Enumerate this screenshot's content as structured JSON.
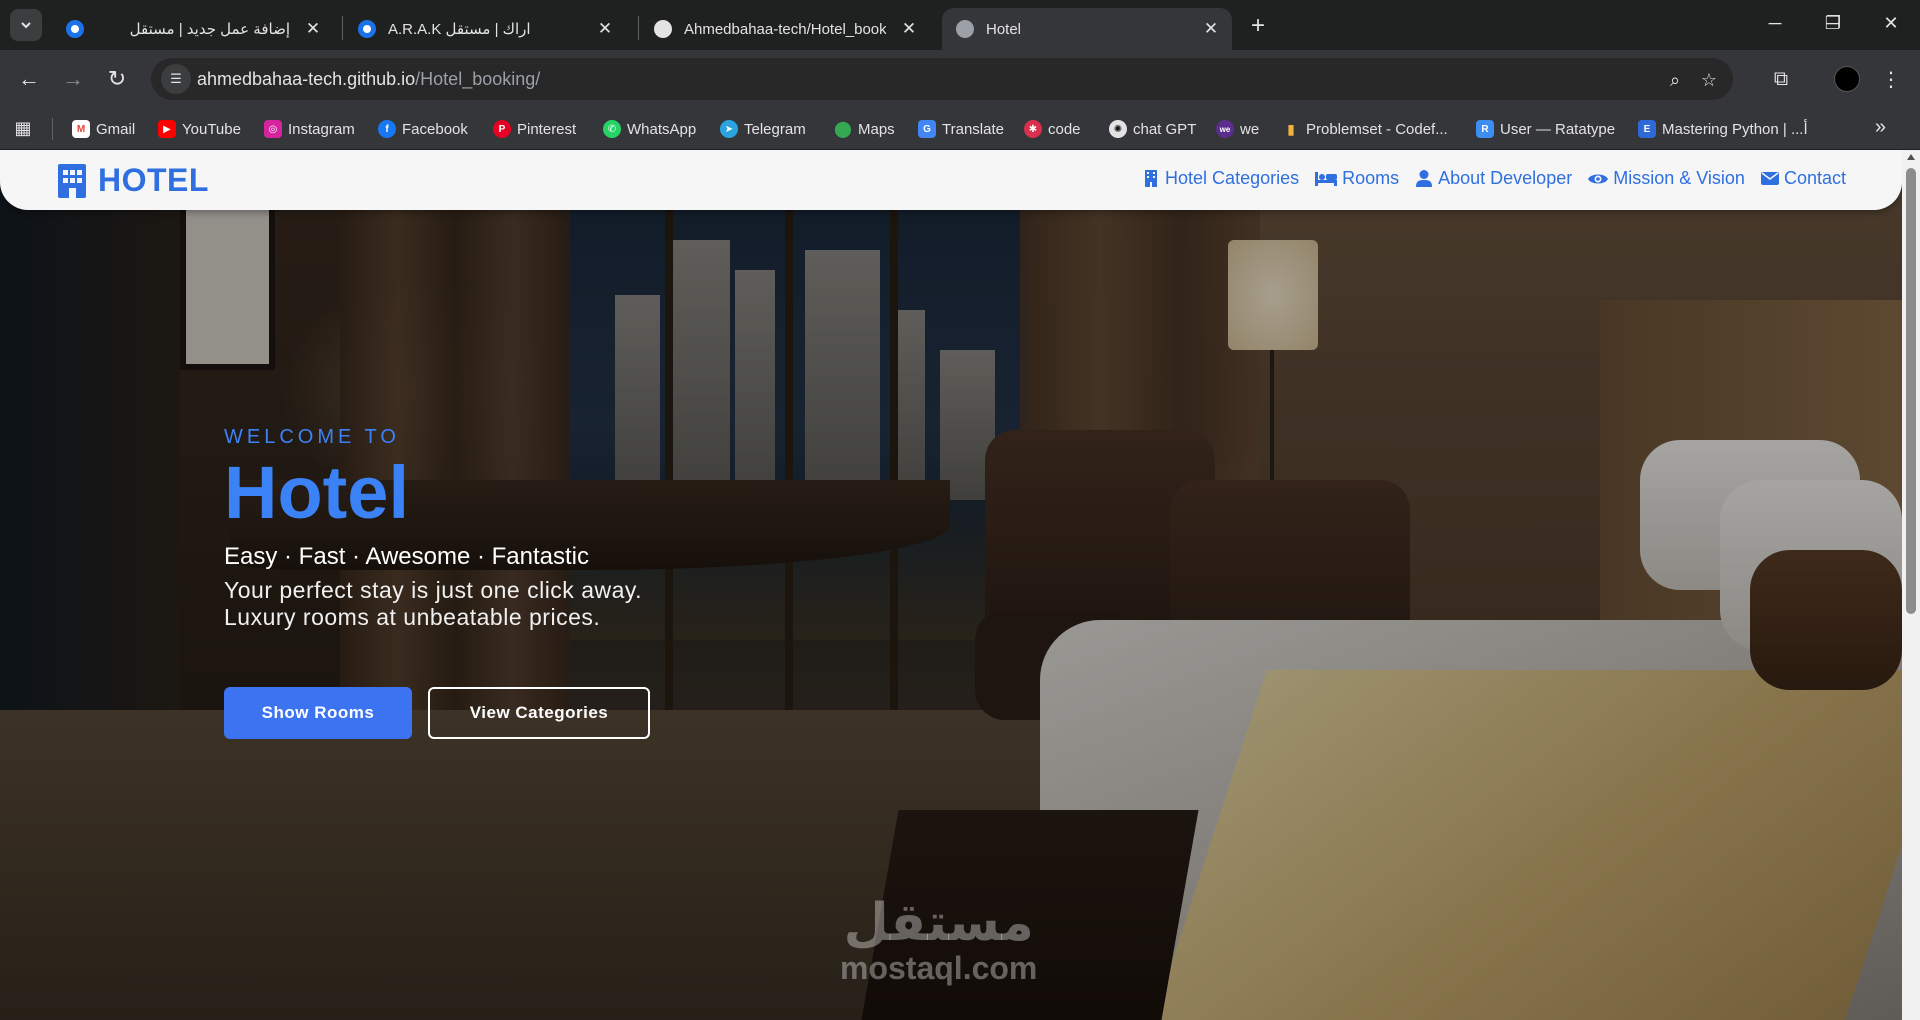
{
  "browser": {
    "tabs": [
      {
        "title": "إضافة عمل جديد | مستقل",
        "favicon": "mostaql-icon",
        "active": false
      },
      {
        "title": "A.R.A.K اراك | مستقل",
        "favicon": "mostaql-icon",
        "active": false
      },
      {
        "title": "Ahmedbahaa-tech/Hotel_booking",
        "favicon": "github-icon",
        "active": false
      },
      {
        "title": "Hotel",
        "favicon": "globe-icon",
        "active": true
      }
    ],
    "url_host": "ahmedbahaa-tech.github.io",
    "url_path": "/Hotel_booking/",
    "bookmarks": [
      {
        "label": "Gmail",
        "color": "#ea4335"
      },
      {
        "label": "YouTube",
        "color": "#ff0000"
      },
      {
        "label": "Instagram",
        "color": "#d6249f"
      },
      {
        "label": "Facebook",
        "color": "#1877f2"
      },
      {
        "label": "Pinterest",
        "color": "#e60023"
      },
      {
        "label": "WhatsApp",
        "color": "#25d366"
      },
      {
        "label": "Telegram",
        "color": "#2aa3e0"
      },
      {
        "label": "Maps",
        "color": "#34a853"
      },
      {
        "label": "Translate",
        "color": "#4285f4"
      },
      {
        "label": "code",
        "color": "#d9304f"
      },
      {
        "label": "chat GPT",
        "color": "#e3e3e3"
      },
      {
        "label": "we",
        "color": "#5b2d8e"
      },
      {
        "label": "Problemset - Codef...",
        "color": "#f2b33d"
      },
      {
        "label": "User — Ratatype",
        "color": "#3d8ef2"
      },
      {
        "label": "Mastering Python | ...أ",
        "color": "#2d6ad8"
      }
    ]
  },
  "site": {
    "brand": "HOTEL",
    "nav": [
      {
        "label": "Hotel Categories",
        "icon": "building-icon"
      },
      {
        "label": "Rooms",
        "icon": "bed-icon"
      },
      {
        "label": "About Developer",
        "icon": "user-icon"
      },
      {
        "label": "Mission & Vision",
        "icon": "eye-icon"
      },
      {
        "label": "Contact",
        "icon": "envelope-icon"
      }
    ],
    "hero": {
      "welcome": "WELCOME TO",
      "title": "Hotel",
      "tagline": "Easy · Fast · Awesome · Fantastic",
      "desc_line1": "Your perfect stay is just one click away.",
      "desc_line2": "Luxury rooms at unbeatable prices.",
      "primary_button": "Show Rooms",
      "secondary_button": "View Categories"
    },
    "watermark": {
      "arabic": "مستقل",
      "english": "mostaql.com"
    },
    "accent_color": "#3b82f6"
  }
}
